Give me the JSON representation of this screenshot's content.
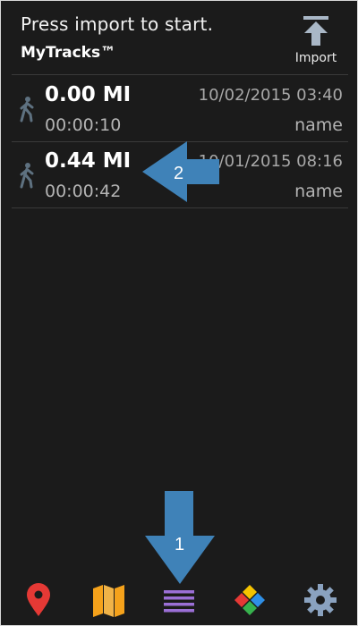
{
  "header": {
    "prompt": "Press import to start.",
    "app_title": "MyTracks™",
    "import_label": "Import"
  },
  "tracks": [
    {
      "distance": "0.00 MI",
      "duration": "00:00:10",
      "datetime": "10/02/2015 03:40",
      "name": "name",
      "activity_icon": "walking-person-icon"
    },
    {
      "distance": "0.44 MI",
      "duration": "00:00:42",
      "datetime": "10/01/2015 08:16",
      "name": "name",
      "activity_icon": "walking-person-icon"
    }
  ],
  "annotations": [
    {
      "number": "1",
      "direction": "down"
    },
    {
      "number": "2",
      "direction": "left"
    }
  ],
  "bottom_nav": {
    "items": [
      {
        "icon": "map-pin-icon",
        "color": "#e53935"
      },
      {
        "icon": "folded-map-icon",
        "color": "#f5a21b"
      },
      {
        "icon": "list-icon",
        "color": "#9b6fd6",
        "active": true
      },
      {
        "icon": "puzzle-icon",
        "colors": [
          "#f5c300",
          "#e53935",
          "#37b24d",
          "#2f8fe6"
        ]
      },
      {
        "icon": "gear-icon",
        "color": "#8aa2bf"
      }
    ]
  },
  "colors": {
    "background": "#1b1b1b",
    "annotation_arrow": "#3f82b8",
    "divider": "#3a3a3a"
  }
}
